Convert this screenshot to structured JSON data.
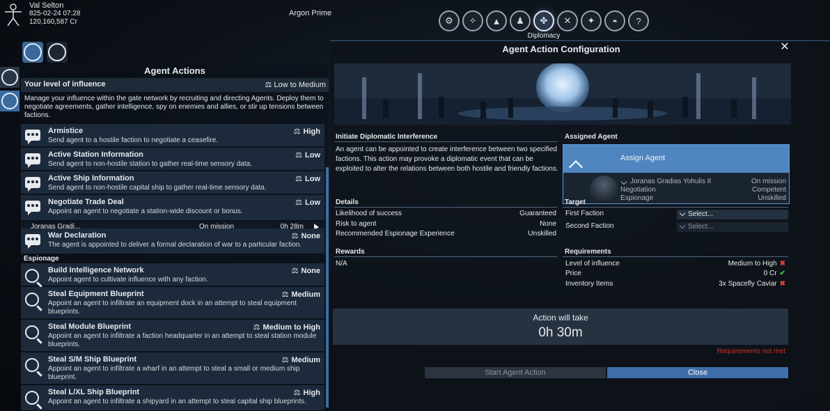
{
  "player": {
    "name": "Val Selton",
    "datetime": "825-02-24 07:28",
    "credits": "120,160,587 Cr",
    "sector": "Argon Prime"
  },
  "top_tabs": {
    "active_label": "Diplomacy",
    "icons": [
      "gear-icon",
      "compass-icon",
      "ship-icon",
      "person-icon",
      "handshake-icon",
      "crossed-swords-icon",
      "map-icon",
      "helmet-icon",
      "question-icon"
    ]
  },
  "left": {
    "title": "Agent Actions",
    "influence_label": "Your level of influence",
    "influence_value": "Low to Medium",
    "description": "Manage your influence within the gate network by recruiting and directing Agents. Deploy them to negotiate agreements, gather intelligence, spy on enemies and allies, or stir up tensions between factions.",
    "actions": [
      {
        "title": "Armistice",
        "req": "High",
        "desc": "Send agent to a hostile faction to negotiate a ceasefire."
      },
      {
        "title": "Active Station Information",
        "req": "Low",
        "desc": "Send agent to non-hostile station to gather real-time sensory data."
      },
      {
        "title": "Active Ship Information",
        "req": "Low",
        "desc": "Send agent to non-hostile capital ship to gather real-time sensory data."
      },
      {
        "title": "Negotiate Trade Deal",
        "req": "Low",
        "desc": "Appoint an agent to negotiate a station-wide discount or bonus."
      },
      {
        "title": "War Declaration",
        "req": "None",
        "desc": "The agent is appointed to deliver a formal declaration of war to a particular faction."
      }
    ],
    "mission": {
      "agent": "Joranas Gradi...",
      "status": "On mission",
      "time": "0h 28m"
    },
    "espionage_header": "Espionage",
    "espionage": [
      {
        "title": "Build Intelligence Network",
        "req": "None",
        "desc": "Appoint agent to cultivate influence with any faction."
      },
      {
        "title": "Steal Equipment Blueprint",
        "req": "Medium",
        "desc": "Appoint an agent to infiltrate an equipment dock in an attempt to steal equipment blueprints."
      },
      {
        "title": "Steal Module Blueprint",
        "req": "Medium to High",
        "desc": "Appoint an agent to infiltrate a faction headquarter in an attempt to steal station module blueprints."
      },
      {
        "title": "Steal S/M Ship Blueprint",
        "req": "Medium",
        "desc": "Appoint an agent to infiltrate a wharf in an attempt to steal a small or medium ship blueprint."
      },
      {
        "title": "Steal L/XL Ship Blueprint",
        "req": "High",
        "desc": "Appoint an agent to infiltrate a shipyard in an attempt to steal capital ship blueprints."
      }
    ]
  },
  "right": {
    "title": "Agent Action Configuration",
    "action_title": "Initiate Diplomatic Interference",
    "action_desc": "An agent can be appointed to create interference between two specified factions. This action may provoke a diplomatic event that can be exploited to alter the relations between both hostile and friendly factions.",
    "assigned_agent_header": "Assigned Agent",
    "assign_label": "Assign Agent",
    "agent": {
      "name": "Joranas Gradias Yohulis II",
      "status": "On mission",
      "skill1": "Negotiation",
      "skill1_value": "Competent",
      "skill2": "Espionage",
      "skill2_value": "Unskilled"
    },
    "details_header": "Details",
    "details": [
      {
        "k": "Likelihood of success",
        "v": "Guaranteed"
      },
      {
        "k": "Risk to agent",
        "v": "None"
      },
      {
        "k": "Recommended Espionage Experience",
        "v": "Unskilled"
      }
    ],
    "target_header": "Target",
    "first_faction_label": "First Faction",
    "second_faction_label": "Second Faction",
    "select_placeholder": "Select...",
    "rewards_header": "Rewards",
    "rewards_value": "N/A",
    "requirements_header": "Requirements",
    "requirements": [
      {
        "k": "Level of influence",
        "v": "Medium to High",
        "ok": false
      },
      {
        "k": "Price",
        "v": "0 Cr",
        "ok": true
      },
      {
        "k": "Inventory Items",
        "v": "3x Spacefly Caviar",
        "ok": false
      }
    ],
    "duration_label": "Action will take",
    "duration_value": "0h 30m",
    "warning": "Requirements not met",
    "start_label": "Start Agent Action",
    "close_label": "Close",
    "colors": {
      "ok": "#48c04d",
      "fail": "#e0443c",
      "accent": "#4f86c0"
    }
  }
}
